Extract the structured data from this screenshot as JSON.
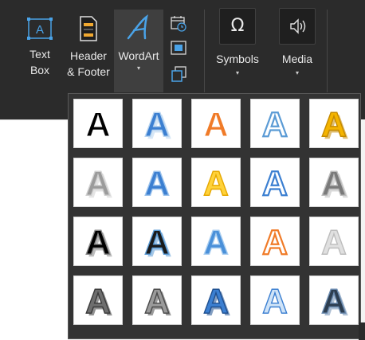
{
  "ribbon": {
    "textbox": {
      "line1": "Text",
      "line2": "Box"
    },
    "header_footer": {
      "line1": "Header",
      "line2": "& Footer"
    },
    "wordart": {
      "label": "WordArt",
      "caret": "▾"
    },
    "symbols": {
      "label": "Symbols",
      "glyph": "Ω",
      "caret": "▾"
    },
    "media": {
      "label": "Media",
      "caret": "▾"
    },
    "small_icons": [
      "date-time-icon",
      "object-icon",
      "layers-icon"
    ]
  },
  "gallery": {
    "glyph": "A",
    "rows": [
      [
        {
          "name": "wordart-style-1-1",
          "fill": "#000000",
          "stroke": "#ffffff",
          "style": "black-outline"
        },
        {
          "name": "wordart-style-1-2",
          "fill": "#3b7fd1",
          "stroke": "#b8d4f0",
          "style": "blue-gradient"
        },
        {
          "name": "wordart-style-1-3",
          "fill": "#f07b28",
          "stroke": "#ffffff",
          "style": "orange-inline"
        },
        {
          "name": "wordart-style-1-4",
          "fill": "#ffffff",
          "stroke": "#5b9bd5",
          "style": "outline-blue"
        },
        {
          "name": "wordart-style-1-5",
          "fill": "#f4b400",
          "stroke": "#c58a00",
          "style": "gold-gradient"
        }
      ],
      [
        {
          "name": "wordart-style-2-1",
          "fill": "#9b9b9b",
          "stroke": "#d0d0d0",
          "style": "gray-gradient"
        },
        {
          "name": "wordart-style-2-2",
          "fill": "#3b7fd1",
          "stroke": "#9cc3ec",
          "style": "blue-reflection"
        },
        {
          "name": "wordart-style-2-3",
          "fill": "#ffd23a",
          "stroke": "#e6a800",
          "style": "gold-bevel"
        },
        {
          "name": "wordart-style-2-4",
          "fill": "#ffffff",
          "stroke": "#3b7fd1",
          "style": "blue-outline-bold"
        },
        {
          "name": "wordart-style-2-5",
          "fill": "#7a7a7a",
          "stroke": "#bcbcbc",
          "style": "gray-3d"
        }
      ],
      [
        {
          "name": "wordart-style-3-1",
          "fill": "#000000",
          "stroke": "#888888",
          "style": "black-shadow"
        },
        {
          "name": "wordart-style-3-2",
          "fill": "#1a1a1a",
          "stroke": "#5b9bd5",
          "style": "black-blue-shadow"
        },
        {
          "name": "wordart-style-3-3",
          "fill": "#4a90d9",
          "stroke": "#a8cdf0",
          "style": "blue-soft"
        },
        {
          "name": "wordart-style-3-4",
          "fill": "#ffffff",
          "stroke": "#f07b28",
          "style": "orange-outline"
        },
        {
          "name": "wordart-style-3-5",
          "fill": "#e0e0e0",
          "stroke": "#bdbdbd",
          "style": "silver"
        }
      ],
      [
        {
          "name": "wordart-style-4-1",
          "fill": "#6e6e6e",
          "stroke": "#3a3a3a",
          "style": "gray-striped"
        },
        {
          "name": "wordart-style-4-2",
          "fill": "#9a9a9a",
          "stroke": "#4a4a4a",
          "style": "gray-hatched"
        },
        {
          "name": "wordart-style-4-3",
          "fill": "#3b7fd1",
          "stroke": "#1f4f8f",
          "style": "blue-pattern"
        },
        {
          "name": "wordart-style-4-4",
          "fill": "#cfe3f7",
          "stroke": "#3b7fd1",
          "style": "light-blue-outline"
        },
        {
          "name": "wordart-style-4-5",
          "fill": "#2d3e50",
          "stroke": "#6b8bb0",
          "style": "navy-hatched"
        }
      ]
    ]
  }
}
